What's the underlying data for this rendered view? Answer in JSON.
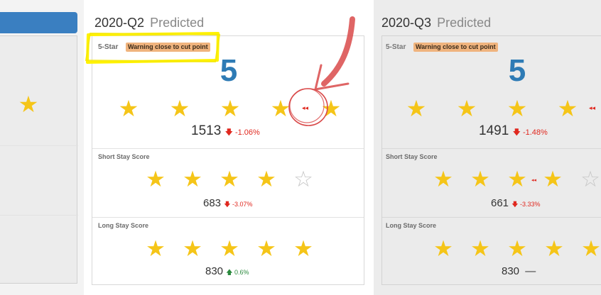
{
  "col1": {
    "star": "★"
  },
  "q2": {
    "period": "2020-Q2",
    "status": "Predicted",
    "overall": {
      "label": "5-Star",
      "warning": "Warning close to cut point",
      "rating": "5",
      "stars": 5,
      "score": "1513",
      "change": "-1.06%",
      "change_dir": "down"
    },
    "short_stay": {
      "label": "Short Stay Score",
      "stars": 4,
      "score": "683",
      "change": "-3.07%",
      "change_dir": "down"
    },
    "long_stay": {
      "label": "Long Stay Score",
      "stars": 5,
      "score": "830",
      "change": "0.6%",
      "change_dir": "up"
    }
  },
  "q3": {
    "period": "2020-Q3",
    "status": "Predicted",
    "overall": {
      "label": "5-Star",
      "warning": "Warning close to cut point",
      "rating": "5",
      "score": "1491",
      "change": "-1.48%",
      "change_dir": "down"
    },
    "short_stay": {
      "label": "Short Stay Score",
      "score": "661",
      "change": "-3.33%",
      "change_dir": "down"
    },
    "long_stay": {
      "label": "Long Stay Score",
      "score": "830",
      "change": "—"
    }
  },
  "icons": {
    "arrow_down": "🡇",
    "arrow_up": "🡅",
    "double_left": "◂◂"
  },
  "colors": {
    "accent_blue": "#2e7bb5",
    "header_blue": "#3a7fc1",
    "star_gold": "#f5c518",
    "warning_orange": "#f0b47e",
    "decline_red": "#e0281f",
    "gain_green": "#2b8a3e",
    "highlight_yellow": "#fff200",
    "annotation_red": "#d94a4a"
  }
}
